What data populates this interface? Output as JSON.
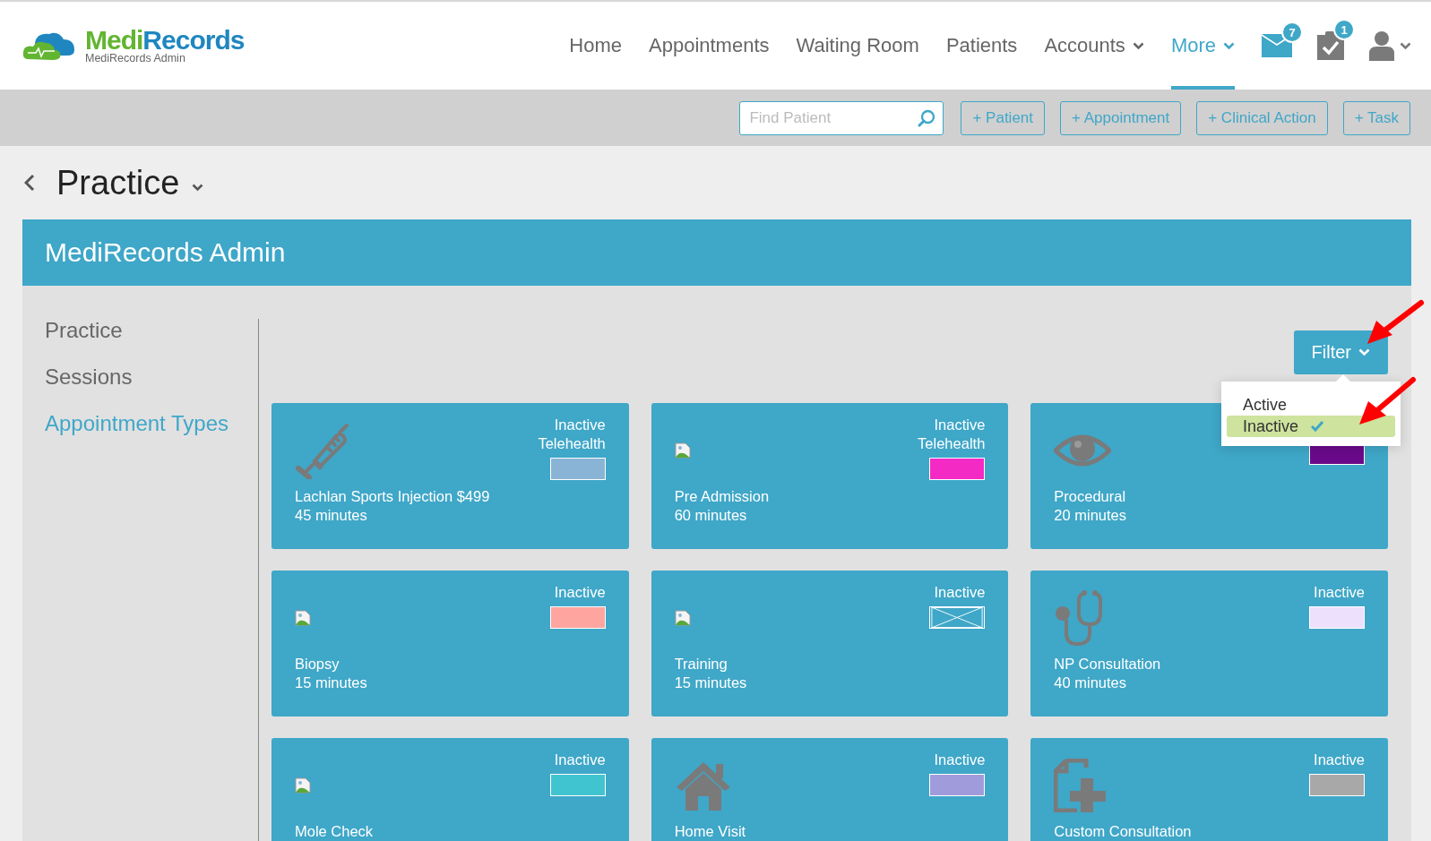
{
  "brand": {
    "parts": [
      "Medi",
      "Records"
    ],
    "subtitle": "MediRecords Admin"
  },
  "nav": [
    {
      "label": "Home",
      "selected": false,
      "dropdown": false
    },
    {
      "label": "Appointments",
      "selected": false,
      "dropdown": false
    },
    {
      "label": "Waiting Room",
      "selected": false,
      "dropdown": false
    },
    {
      "label": "Patients",
      "selected": false,
      "dropdown": false
    },
    {
      "label": "Accounts",
      "selected": false,
      "dropdown": true
    },
    {
      "label": "More",
      "selected": true,
      "dropdown": true
    }
  ],
  "header_icons": [
    {
      "kind": "mail",
      "badge": "7"
    },
    {
      "kind": "tasks",
      "badge": "1"
    },
    {
      "kind": "user"
    }
  ],
  "toolbar": {
    "search": {
      "placeholder": "Find Patient"
    },
    "buttons": [
      "+ Patient",
      "+ Appointment",
      "+ Clinical Action",
      "+ Task"
    ]
  },
  "page_title": "Practice",
  "banner": "MediRecords Admin",
  "sidebar": {
    "items": [
      {
        "label": "Practice",
        "selected": false
      },
      {
        "label": "Sessions",
        "selected": false
      },
      {
        "label": "Appointment Types",
        "selected": true
      }
    ]
  },
  "filter": {
    "label": "Filter",
    "options": [
      {
        "label": "Active",
        "selected": false
      },
      {
        "label": "Inactive",
        "selected": true
      }
    ]
  },
  "cards": [
    {
      "kind": "syringe",
      "name": "Lachlan Sports Injection $499",
      "duration": "45 minutes",
      "tags": [
        "Inactive",
        "Telehealth"
      ],
      "color": "#8ab4d6"
    },
    {
      "kind": "broken-image",
      "name": "Pre Admission",
      "duration": "60 minutes",
      "tags": [
        "Inactive",
        "Telehealth"
      ],
      "color": "#f42ac4"
    },
    {
      "kind": "eye",
      "name": "Procedural",
      "duration": "20 minutes",
      "color": "#6a0a8a"
    },
    {
      "kind": "broken-image",
      "name": "Biopsy",
      "duration": "15 minutes",
      "tags": [
        "Inactive"
      ],
      "color": "#ffa5a0"
    },
    {
      "kind": "broken-image",
      "name": "Training",
      "duration": "15 minutes",
      "tags": [
        "Inactive"
      ]
    },
    {
      "kind": "stethoscope",
      "name": "NP Consultation",
      "duration": "40 minutes",
      "tags": [
        "Inactive"
      ],
      "color": "#ece0fc"
    },
    {
      "kind": "broken-image",
      "name": "Mole Check",
      "tags": [
        "Inactive"
      ],
      "color": "#40c4d0"
    },
    {
      "kind": "house",
      "name": "Home Visit",
      "tags": [
        "Inactive"
      ],
      "color": "#a09cdc"
    },
    {
      "kind": "document-plus",
      "name": "Custom Consultation",
      "tags": [
        "Inactive"
      ],
      "color": "#a8a8a8"
    }
  ]
}
